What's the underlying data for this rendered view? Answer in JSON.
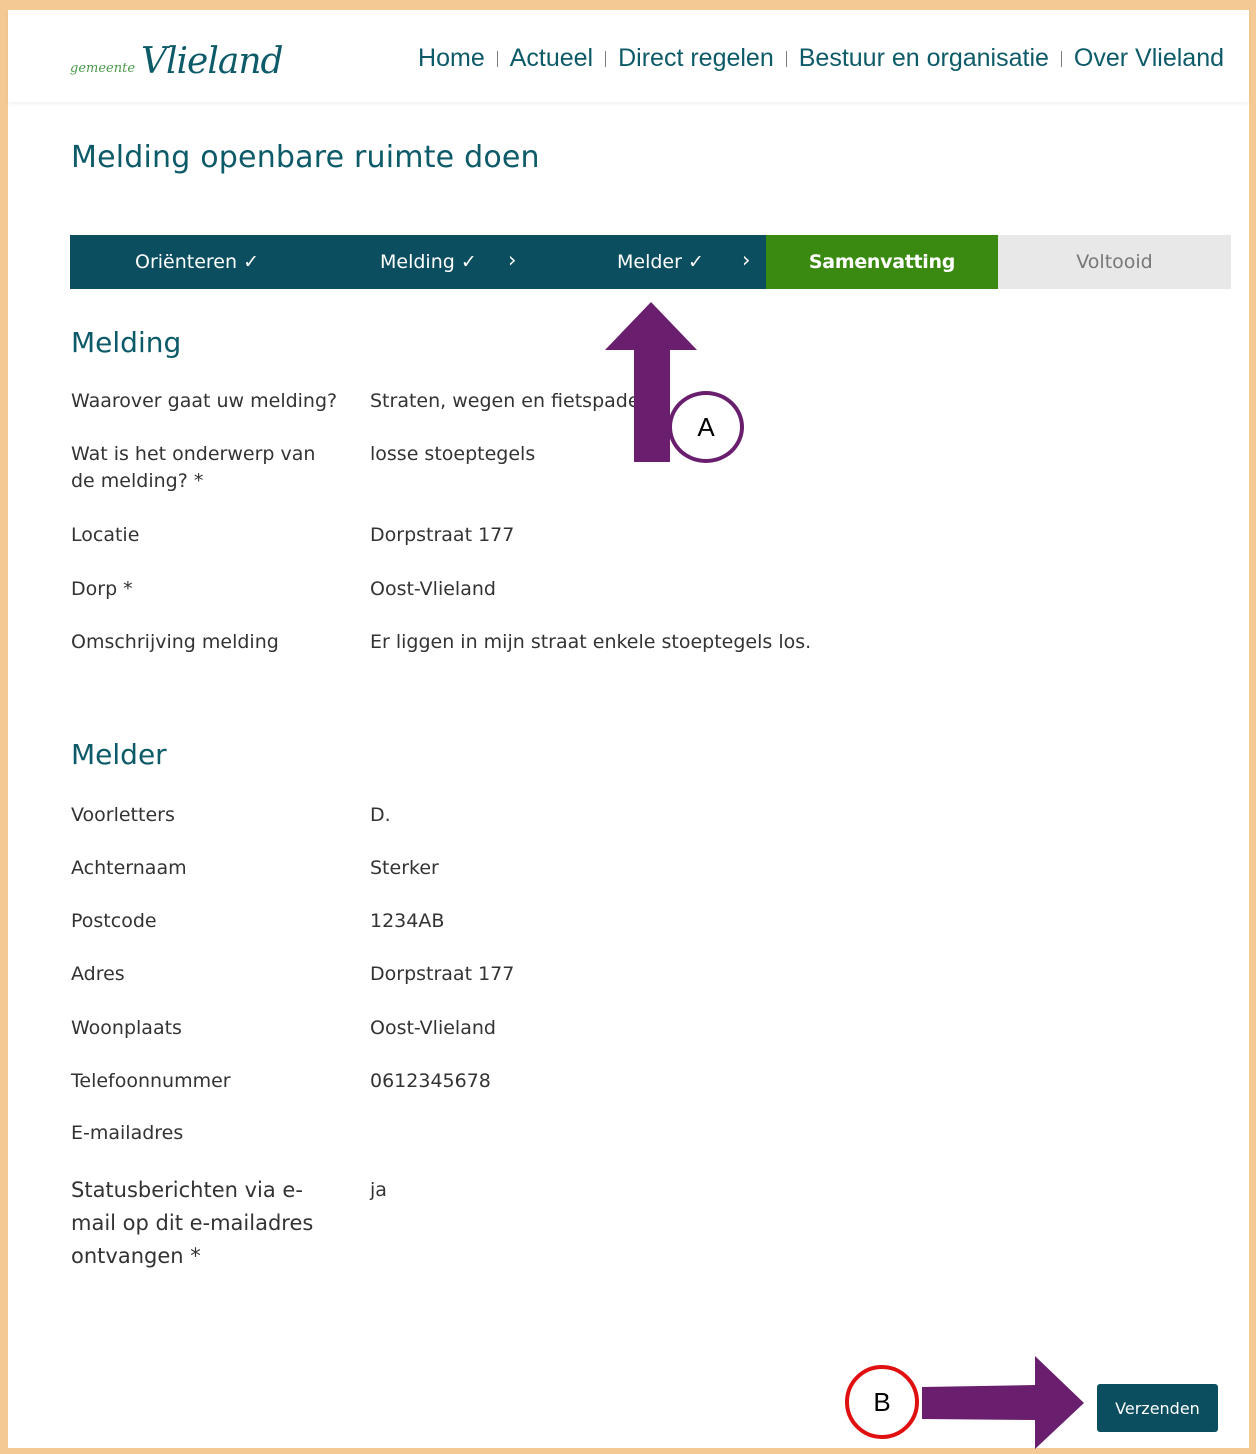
{
  "header": {
    "logo_small": "gemeente",
    "logo_big": "Vlieland",
    "nav": [
      "Home",
      "Actueel",
      "Direct regelen",
      "Bestuur en organisatie",
      "Over Vlieland"
    ]
  },
  "page_title": "Melding openbare ruimte doen",
  "steps": {
    "orienteren": "Oriënteren ✓",
    "melding": "Melding ✓",
    "melder": "Melder ✓",
    "chevron": "›",
    "samenvatting": "Samenvatting",
    "voltooid": "Voltooid"
  },
  "melding": {
    "title": "Melding",
    "rows": [
      {
        "label": "Waarover gaat uw melding?",
        "value": "Straten, wegen en fietspaden"
      },
      {
        "label": "Wat is het onderwerp van de melding? *",
        "value": "losse stoeptegels"
      },
      {
        "label": "Locatie",
        "value": "Dorpstraat 177"
      },
      {
        "label": "Dorp *",
        "value": "Oost-Vlieland"
      },
      {
        "label": "Omschrijving melding",
        "value": "Er liggen in mijn straat enkele stoeptegels los."
      }
    ]
  },
  "melder": {
    "title": "Melder",
    "rows": [
      {
        "label": "Voorletters",
        "value": "D."
      },
      {
        "label": "Achternaam",
        "value": "Sterker"
      },
      {
        "label": "Postcode",
        "value": "1234AB"
      },
      {
        "label": "Adres",
        "value": "Dorpstraat 177"
      },
      {
        "label": "Woonplaats",
        "value": "Oost-Vlieland"
      },
      {
        "label": "Telefoonnummer",
        "value": "0612345678"
      },
      {
        "label": "E-mailadres",
        "value": ""
      },
      {
        "label": "Statusberichten via e-mail op dit e-mailadres ontvangen *",
        "value": "ja"
      }
    ]
  },
  "submit_label": "Verzenden",
  "annotations": {
    "a_label": "A",
    "b_label": "B",
    "arrow_color": "#6a1f6e",
    "circle_b_color": "#e01010"
  }
}
